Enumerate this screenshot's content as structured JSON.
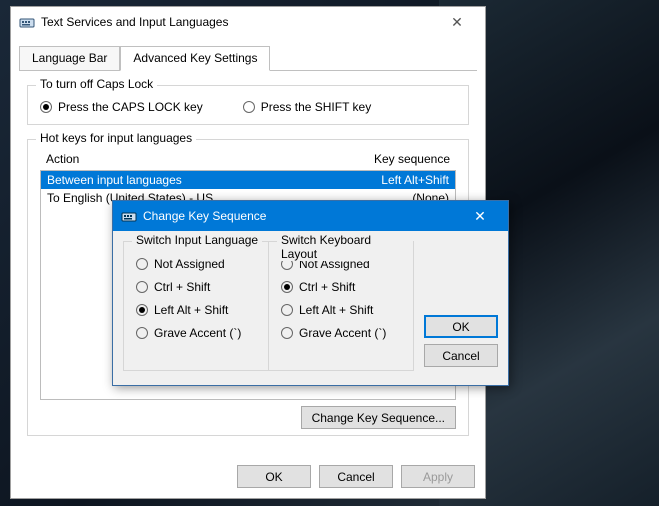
{
  "parent": {
    "title": "Text Services and Input Languages",
    "tabs": {
      "lang_bar": "Language Bar",
      "adv": "Advanced Key Settings"
    },
    "caps_group": {
      "title": "To turn off Caps Lock",
      "opt_caps": "Press the CAPS LOCK key",
      "opt_shift": "Press the SHIFT key"
    },
    "hotkeys": {
      "title": "Hot keys for input languages",
      "col_action": "Action",
      "col_seq": "Key sequence",
      "rows": [
        {
          "action": "Between input languages",
          "seq": "Left Alt+Shift"
        },
        {
          "action": "To English (United States) - US",
          "seq": "(None)"
        }
      ],
      "change_btn": "Change Key Sequence..."
    },
    "buttons": {
      "ok": "OK",
      "cancel": "Cancel",
      "apply": "Apply"
    }
  },
  "child": {
    "title": "Change Key Sequence",
    "group_input": {
      "title": "Switch Input Language",
      "opt_na": "Not Assigned",
      "opt_ctrl": "Ctrl + Shift",
      "opt_lalt": "Left Alt + Shift",
      "opt_grave": "Grave Accent (`)"
    },
    "group_layout": {
      "title": "Switch Keyboard Layout",
      "opt_na": "Not Assigned",
      "opt_ctrl": "Ctrl + Shift",
      "opt_lalt": "Left Alt + Shift",
      "opt_grave": "Grave Accent (`)"
    },
    "buttons": {
      "ok": "OK",
      "cancel": "Cancel"
    }
  }
}
